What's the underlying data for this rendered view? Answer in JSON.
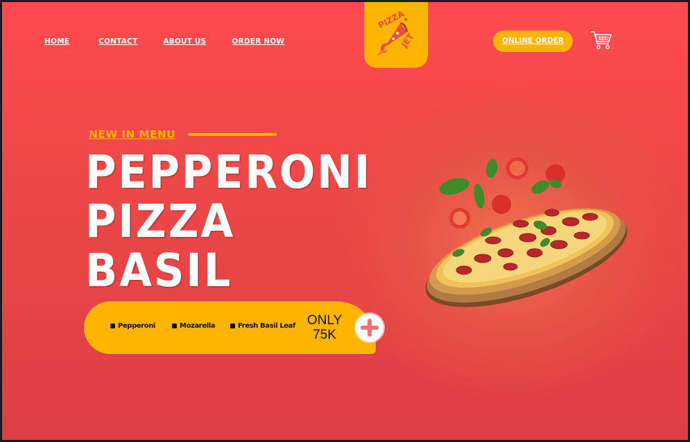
{
  "nav": {
    "items": [
      {
        "label": "HOME"
      },
      {
        "label": "CONTACT"
      },
      {
        "label": "ABOUT US"
      },
      {
        "label": "ORDER NOW"
      }
    ]
  },
  "logo": {
    "line1": "PIZZA",
    "line2": "JET"
  },
  "header": {
    "online_order_label": "ONLINE ORDER",
    "cart_icon": "shopping-cart-icon"
  },
  "hero": {
    "eyebrow": "NEW IN MENU",
    "title_lines": [
      "PEPPERONI",
      "PIZZA",
      "BASIL"
    ],
    "ingredients": [
      "Pepperoni",
      "Mozarella",
      "Fresh Basil Leaf"
    ],
    "price_line1": "ONLY",
    "price_line2": "75K",
    "add_icon": "plus-icon"
  },
  "colors": {
    "background": "#f04848",
    "accent": "#ffb400",
    "text_light": "#ffffff",
    "text_dark": "#111111"
  }
}
